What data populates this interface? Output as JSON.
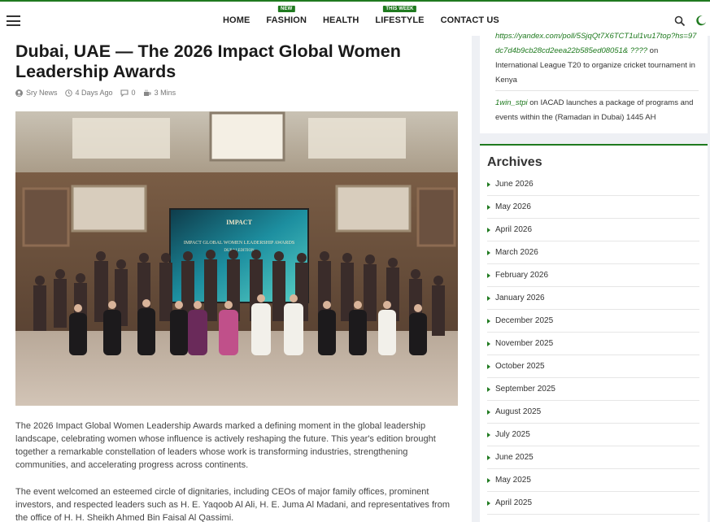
{
  "header": {
    "nav": [
      {
        "label": "HOME"
      },
      {
        "label": "FASHION",
        "badge": "NEW"
      },
      {
        "label": "HEALTH"
      },
      {
        "label": "LIFESTYLE",
        "badge": "THIS WEEK"
      },
      {
        "label": "CONTACT US"
      }
    ],
    "icons": {
      "menu": "hamburger-icon",
      "search": "search-icon",
      "theme": "moon-icon"
    }
  },
  "article": {
    "title": "Dubai, UAE — The 2026 Impact Global Women Leadership Awards",
    "meta": {
      "author": "Sry News",
      "date": "4 Days Ago",
      "comments": "0",
      "read_time": "3 Mins"
    },
    "banner_text": {
      "logo": "IMPACT",
      "headline": "IMPACT GLOBAL WOMEN LEADERSHIP AWARDS",
      "sub": "DUBAI EDITION"
    },
    "paragraphs": [
      "The 2026 Impact Global Women Leadership Awards marked a defining moment in the global leadership landscape, celebrating women whose influence is actively reshaping the future. This year's edition brought together a remarkable constellation of leaders whose work is transforming industries, strengthening communities, and accelerating progress across continents.",
      "The event welcomed an esteemed circle of dignitaries, including CEOs of major family offices, prominent investors, and respected leaders such as H. E. Yaqoob Al Ali, H. E. Juma Al Madani, and representatives from the office of H. H. Sheikh Ahmed Bin Faisal Al Qassimi."
    ]
  },
  "sidebar": {
    "comments": [
      {
        "link": "https://yandex.com/poll/5SjqQt7X6TCT1ul1vu17top?hs=97dc7d4b9cb28cd2eea22b585ed08051& ????",
        "on": "on",
        "post": "International League T20 to organize cricket tournament in Kenya"
      },
      {
        "link": "1win_stpi",
        "on": "on",
        "post": "IACAD launches a package of programs and events within the (Ramadan in Dubai) 1445 AH"
      }
    ],
    "archives_title": "Archives",
    "archives": [
      "June 2026",
      "May 2026",
      "April 2026",
      "March 2026",
      "February 2026",
      "January 2026",
      "December 2025",
      "November 2025",
      "October 2025",
      "September 2025",
      "August 2025",
      "July 2025",
      "June 2025",
      "May 2025",
      "April 2025"
    ]
  },
  "colors": {
    "accent": "#1f7a1f",
    "background": "#eef0f4"
  }
}
